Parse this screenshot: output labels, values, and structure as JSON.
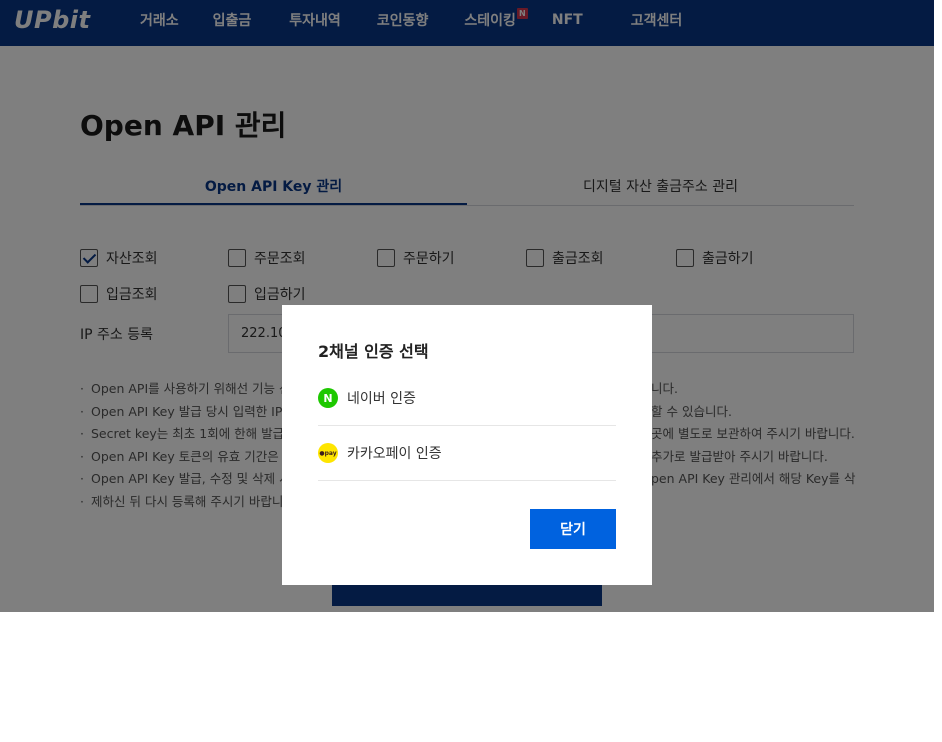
{
  "header": {
    "logo": "UPbit",
    "nav": [
      {
        "label": "거래소"
      },
      {
        "label": "입출금"
      },
      {
        "label": "투자내역"
      },
      {
        "label": "코인동향"
      },
      {
        "label": "스테이킹",
        "badge": "N"
      },
      {
        "label": "NFT"
      },
      {
        "label": "고객센터"
      }
    ]
  },
  "main": {
    "title": "Open API 관리",
    "tabs": [
      {
        "label": "Open API Key 관리",
        "active": true
      },
      {
        "label": "디지털 자산 출금주소 관리",
        "active": false
      }
    ],
    "permissions": [
      {
        "label": "자산조회",
        "checked": true
      },
      {
        "label": "주문조회",
        "checked": false
      },
      {
        "label": "주문하기",
        "checked": false
      },
      {
        "label": "출금조회",
        "checked": false
      },
      {
        "label": "출금하기",
        "checked": false
      },
      {
        "label": "입금조회",
        "checked": false
      },
      {
        "label": "입금하기",
        "checked": false
      }
    ],
    "ip_label": "IP 주소 등록",
    "ip_value": "222.108",
    "notes": [
      "Open API를 사용하기 위해선 기능 선",
      "Open API Key 발급 당시 입력한 IP 주",
      "Secret key는 최초 1회에 한해 발급되",
      "Open API Key 토큰의 유효 기간은 1년",
      "Open API Key 발급, 수정 및 삭제 시어"
    ],
    "notes_right": [
      "니다.",
      "할 수 있습니다.",
      "곳에 별도로 보관하여 주시기 바랍니다.",
      "추가로 발급받아 주시기 바랍니다.",
      "pen API Key 관리에서 해당 Key를 삭"
    ],
    "notes_wrap": "제하신 뒤 다시 등록해 주시기 바랍니다"
  },
  "modal": {
    "title": "2채널 인증 선택",
    "options": [
      {
        "label": "네이버 인증",
        "icon": "naver-icon",
        "glyph": "N",
        "color": "#1ec800"
      },
      {
        "label": "카카오페이 인증",
        "icon": "kakaopay-icon",
        "glyph": "●pay",
        "color": "#fee500"
      }
    ],
    "close_label": "닫기"
  },
  "colors": {
    "brand": "#093687",
    "primary_button": "#0062df"
  }
}
